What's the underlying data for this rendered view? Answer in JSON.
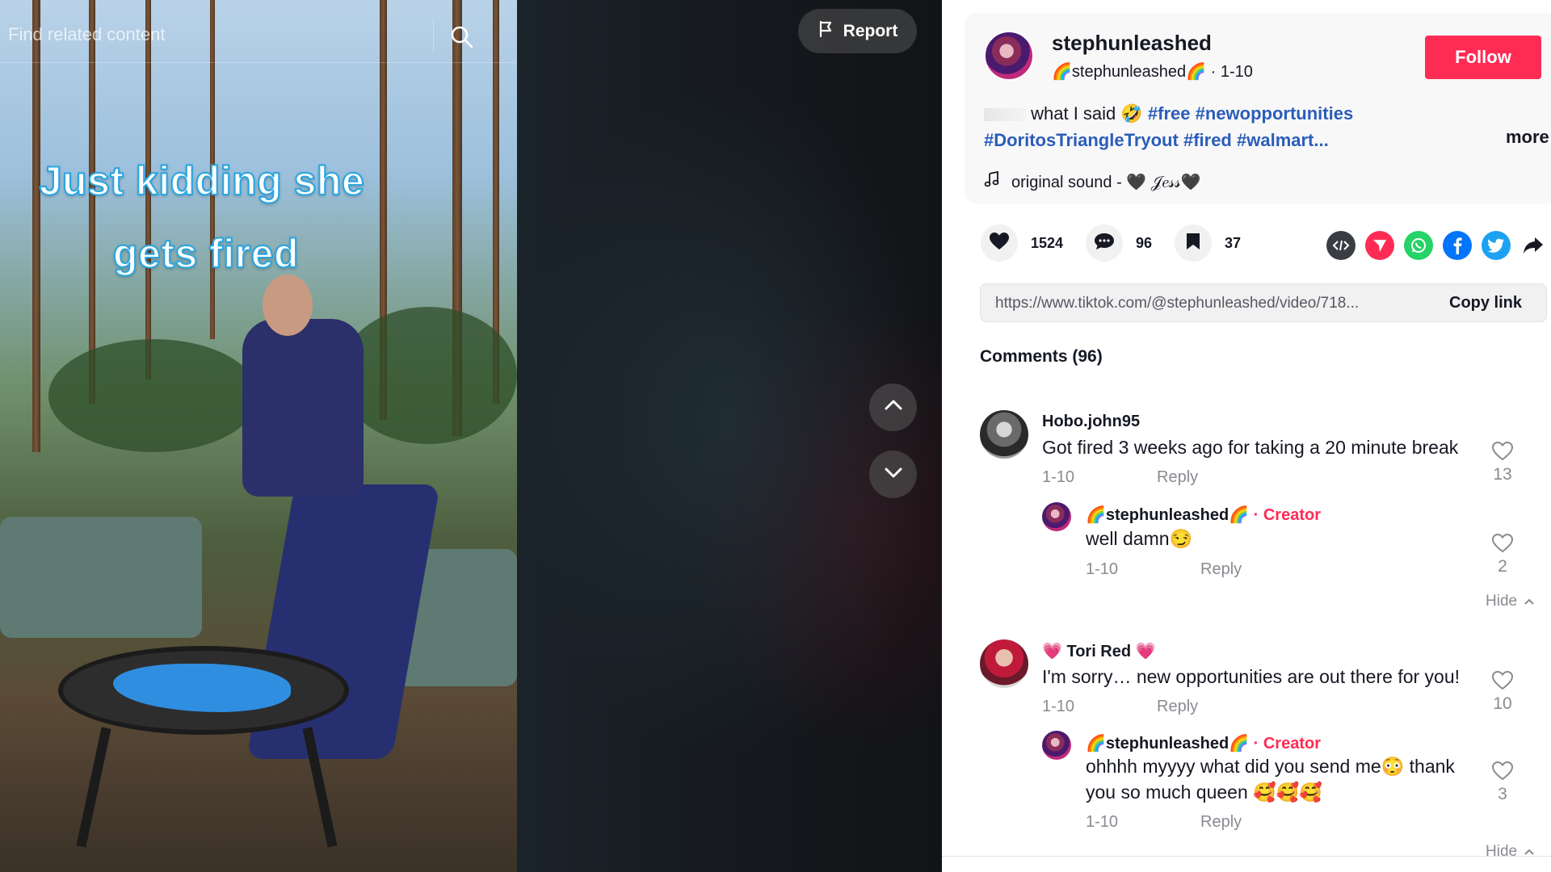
{
  "search": {
    "placeholder": "Find related content"
  },
  "video": {
    "caption_line1": "Just kidding she",
    "caption_line2": "gets fired",
    "report_label": "Report"
  },
  "author": {
    "username": "stephunleashed",
    "nickname": "🌈stephunleashed🌈",
    "date": "1-10",
    "follow_label": "Follow"
  },
  "description": {
    "text": "what I said 🤣",
    "hashtags": [
      "#free",
      "#newopportunities",
      "#DoritosTriangleTryout",
      "#fired",
      "#walmart..."
    ],
    "more_label": "more"
  },
  "sound": {
    "label": "original sound - 🖤 𝒥𝑒𝓈𝓈🖤"
  },
  "actions": {
    "likes": "1524",
    "comments": "96",
    "saves": "37"
  },
  "share": {
    "icons": [
      "embed-icon",
      "send-to-friends-icon",
      "whatsapp-icon",
      "facebook-icon",
      "twitter-icon",
      "share-arrow-icon"
    ],
    "colors": {
      "embed": "#3b3d45",
      "send": "#fe2c55",
      "whatsapp": "#25d366",
      "facebook": "#0075fa",
      "twitter": "#1da1f2"
    }
  },
  "link": {
    "url": "https://www.tiktok.com/@stephunleashed/video/718...",
    "copy_label": "Copy link"
  },
  "comments_title": "Comments (96)",
  "comments": [
    {
      "user": "Hobo.john95",
      "text": "Got fired 3 weeks ago for taking a 20 minute break",
      "date": "1-10",
      "reply_label": "Reply",
      "likes": "13",
      "replies": [
        {
          "user": "🌈stephunleashed🌈",
          "creator_label": "· Creator",
          "text": "well damn😏",
          "date": "1-10",
          "reply_label": "Reply",
          "likes": "2"
        }
      ],
      "hide_label": "Hide"
    },
    {
      "user": "💗 Tori Red 💗",
      "text": "I'm sorry… new opportunities are out there for you!",
      "date": "1-10",
      "reply_label": "Reply",
      "likes": "10",
      "replies": [
        {
          "user": "🌈stephunleashed🌈",
          "creator_label": "· Creator",
          "text_line1": "ohhhh myyyy what did you send me😳 thank",
          "text_line2": "you so much queen 🥰🥰🥰",
          "date": "1-10",
          "reply_label": "Reply",
          "likes": "3"
        }
      ],
      "hide_label": "Hide"
    }
  ],
  "colors": {
    "accent": "#fe2c55",
    "hashtag": "#2b5db9",
    "muted": "#8a8b91"
  }
}
